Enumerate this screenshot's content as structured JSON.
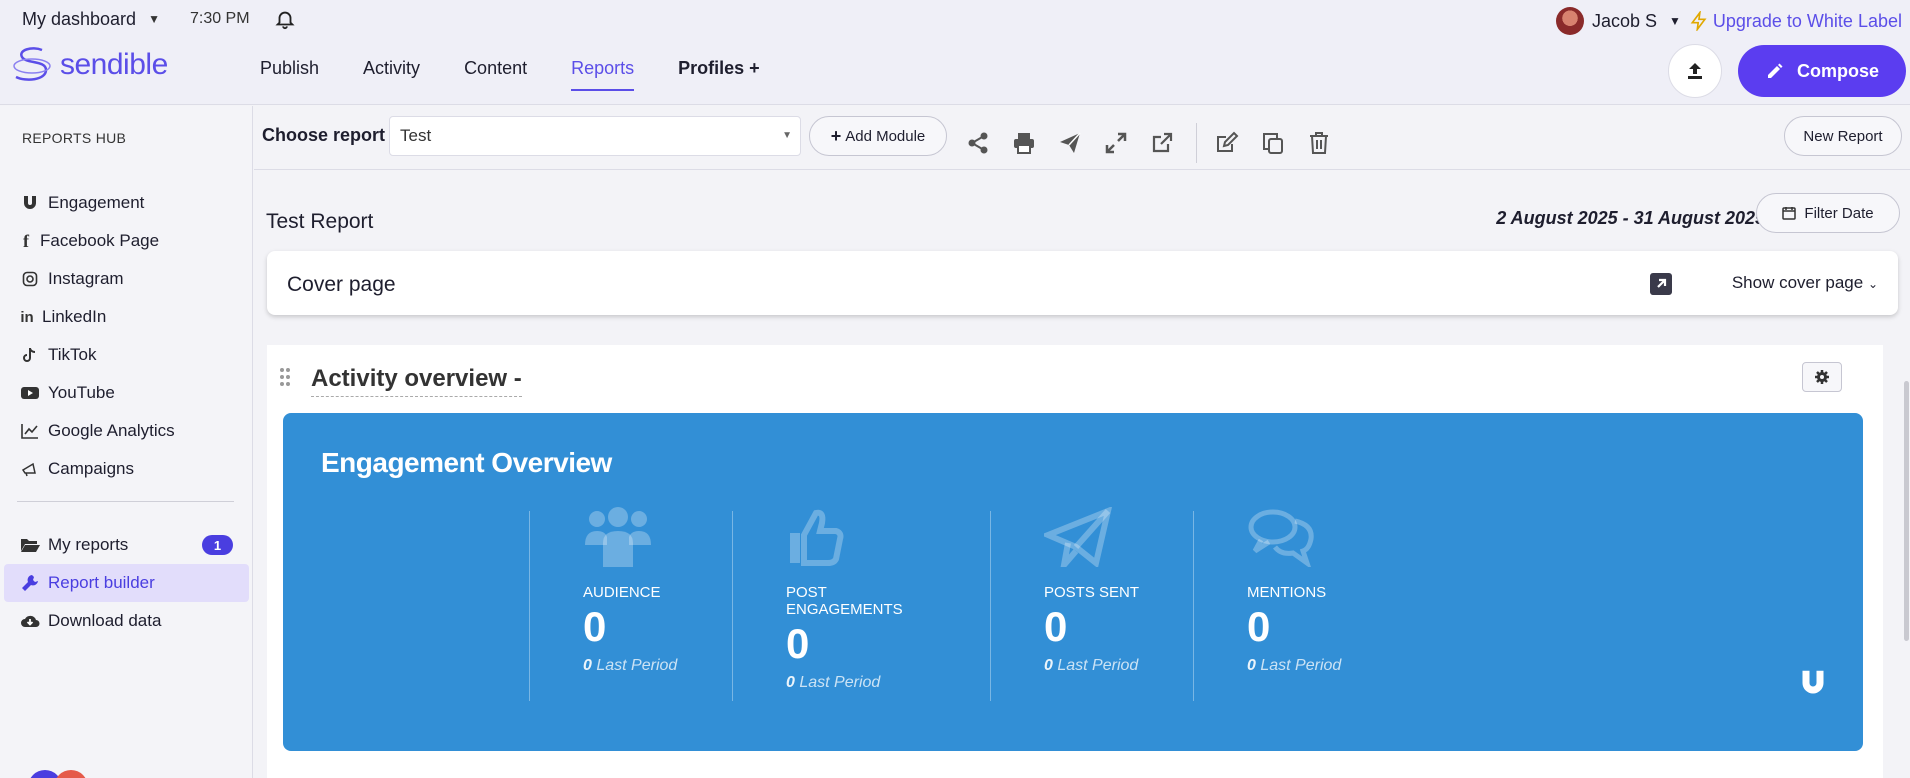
{
  "header": {
    "dashboard_label": "My dashboard",
    "time": "7:30 PM",
    "user_name": "Jacob S",
    "upgrade_label": "Upgrade to White Label",
    "brand": "sendible",
    "accent_color": "#5b3df0"
  },
  "nav": {
    "items": [
      {
        "label": "Publish"
      },
      {
        "label": "Activity"
      },
      {
        "label": "Content"
      },
      {
        "label": "Reports"
      },
      {
        "label": "Profiles +"
      }
    ],
    "active": "Reports"
  },
  "compose_label": "Compose",
  "sidebar": {
    "hub_title": "REPORTS HUB",
    "items": [
      {
        "label": "Engagement",
        "icon": "magnet-icon"
      },
      {
        "label": "Facebook Page",
        "icon": "facebook-icon"
      },
      {
        "label": "Instagram",
        "icon": "instagram-icon"
      },
      {
        "label": "LinkedIn",
        "icon": "linkedin-icon"
      },
      {
        "label": "TikTok",
        "icon": "tiktok-icon"
      },
      {
        "label": "YouTube",
        "icon": "youtube-icon"
      },
      {
        "label": "Google Analytics",
        "icon": "chart-line-icon"
      },
      {
        "label": "Campaigns",
        "icon": "megaphone-icon"
      }
    ],
    "items2": [
      {
        "label": "My reports",
        "icon": "folder-open-icon",
        "badge": "1"
      },
      {
        "label": "Report builder",
        "icon": "wrench-icon"
      },
      {
        "label": "Download data",
        "icon": "cloud-download-icon"
      }
    ]
  },
  "toolbar": {
    "choose_label": "Choose report",
    "selected_report": "Test",
    "add_module_label": "Add Module",
    "new_report_label": "New Report"
  },
  "report": {
    "title": "Test Report",
    "date_range": "2 August 2025 - 31 August 2025",
    "filter_date_label": "Filter Date",
    "cover_title": "Cover page",
    "show_cover_label": "Show cover page"
  },
  "module": {
    "title": "Activity overview -",
    "card_title": "Engagement Overview",
    "card_color": "#328fd6",
    "stats": [
      {
        "label": "AUDIENCE",
        "value": "0",
        "last_value": "0",
        "last_label": "Last Period",
        "icon": "users-icon"
      },
      {
        "label": "POST ENGAGEMENTS",
        "value": "0",
        "last_value": "0",
        "last_label": "Last Period",
        "icon": "thumbs-up-icon"
      },
      {
        "label": "POSTS SENT",
        "value": "0",
        "last_value": "0",
        "last_label": "Last Period",
        "icon": "paper-plane-icon"
      },
      {
        "label": "MENTIONS",
        "value": "0",
        "last_value": "0",
        "last_label": "Last Period",
        "icon": "comments-icon"
      }
    ]
  }
}
